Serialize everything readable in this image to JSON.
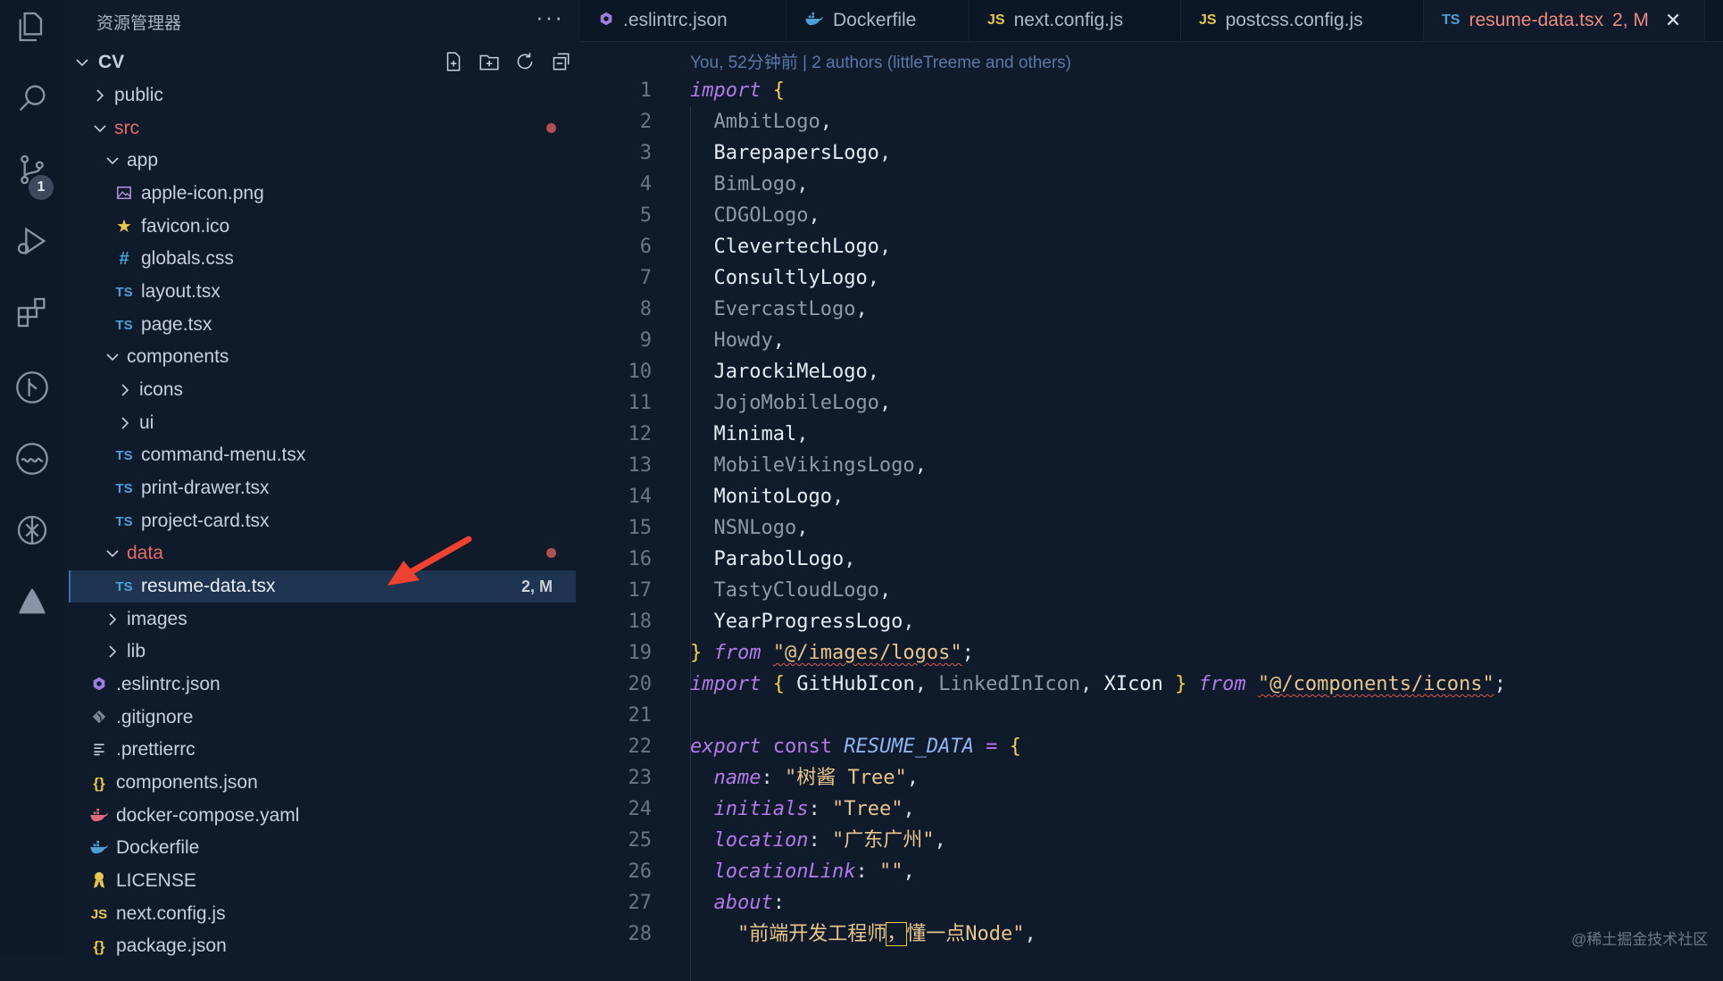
{
  "sidebar": {
    "title": "资源管理器",
    "more": "···",
    "root": "CV",
    "items": [
      {
        "label": "public",
        "kind": "folder-collapsed",
        "depth": 1
      },
      {
        "label": "src",
        "kind": "folder-open",
        "depth": 1,
        "modified": true
      },
      {
        "label": "app",
        "kind": "folder-open",
        "depth": 2
      },
      {
        "label": "apple-icon.png",
        "kind": "image",
        "depth": 3
      },
      {
        "label": "favicon.ico",
        "kind": "star",
        "depth": 3
      },
      {
        "label": "globals.css",
        "kind": "css",
        "depth": 3
      },
      {
        "label": "layout.tsx",
        "kind": "ts",
        "depth": 3
      },
      {
        "label": "page.tsx",
        "kind": "ts",
        "depth": 3
      },
      {
        "label": "components",
        "kind": "folder-open",
        "depth": 2
      },
      {
        "label": "icons",
        "kind": "folder-collapsed",
        "depth": 3
      },
      {
        "label": "ui",
        "kind": "folder-collapsed",
        "depth": 3
      },
      {
        "label": "command-menu.tsx",
        "kind": "ts",
        "depth": 3
      },
      {
        "label": "print-drawer.tsx",
        "kind": "ts",
        "depth": 3
      },
      {
        "label": "project-card.tsx",
        "kind": "ts",
        "depth": 3
      },
      {
        "label": "data",
        "kind": "folder-open",
        "depth": 2,
        "modified": true
      },
      {
        "label": "resume-data.tsx",
        "kind": "ts",
        "depth": 3,
        "status": "2, M",
        "selected": true
      },
      {
        "label": "images",
        "kind": "folder-collapsed",
        "depth": 2
      },
      {
        "label": "lib",
        "kind": "folder-collapsed",
        "depth": 2
      },
      {
        "label": ".eslintrc.json",
        "kind": "eslint",
        "depth": 1
      },
      {
        "label": ".gitignore",
        "kind": "git",
        "depth": 1
      },
      {
        "label": ".prettierrc",
        "kind": "lines",
        "depth": 1
      },
      {
        "label": "components.json",
        "kind": "json",
        "depth": 1
      },
      {
        "label": "docker-compose.yaml",
        "kind": "docker-red",
        "depth": 1
      },
      {
        "label": "Dockerfile",
        "kind": "docker",
        "depth": 1
      },
      {
        "label": "LICENSE",
        "kind": "license",
        "depth": 1
      },
      {
        "label": "next.config.js",
        "kind": "js",
        "depth": 1
      },
      {
        "label": "package.json",
        "kind": "json",
        "depth": 1
      }
    ]
  },
  "activity_badge": "1",
  "tabs": [
    {
      "label": ".eslintrc.json",
      "icon": "eslint-icon"
    },
    {
      "label": "Dockerfile",
      "icon": "docker-icon"
    },
    {
      "label": "next.config.js",
      "icon": "JS"
    },
    {
      "label": "postcss.config.js",
      "icon": "JS"
    },
    {
      "label": "resume-data.tsx",
      "icon": "TS",
      "status": "2, M",
      "active": true
    }
  ],
  "tab_close": "✕",
  "blame": "You, 52分钟前 | 2 authors (littleTreeme and others)",
  "code": {
    "line_numbers": [
      "1",
      "2",
      "3",
      "4",
      "5",
      "6",
      "7",
      "8",
      "9",
      "10",
      "11",
      "12",
      "13",
      "14",
      "15",
      "16",
      "17",
      "18",
      "19",
      "20",
      "21",
      "22",
      "23",
      "24",
      "25",
      "26",
      "27",
      "28"
    ],
    "logos": [
      "AmbitLogo",
      "BarepapersLogo",
      "BimLogo",
      "CDGOLogo",
      "ClevertechLogo",
      "ConsultlyLogo",
      "EvercastLogo",
      "Howdy",
      "JarockiMeLogo",
      "JojoMobileLogo",
      "Minimal",
      "MobileVikingsLogo",
      "MonitoLogo",
      "NSNLogo",
      "ParabolLogo",
      "TastyCloudLogo",
      "YearProgressLogo"
    ],
    "logos_path": "\"@/images/logos\"",
    "icons_import": [
      "GitHubIcon",
      "LinkedInIcon",
      "XIcon"
    ],
    "icons_path": "\"@/components/icons\"",
    "const_name": "RESUME_DATA",
    "fields": {
      "name": "\"树酱 Tree\"",
      "initials": "\"Tree\"",
      "location": "\"广东广州\"",
      "locationLink": "\"\"",
      "about_value_a": "\"前端开发工程师",
      "about_value_comma": "，",
      "about_value_b": "懂一点Node\""
    }
  },
  "watermark": "@稀土掘金技术社区"
}
